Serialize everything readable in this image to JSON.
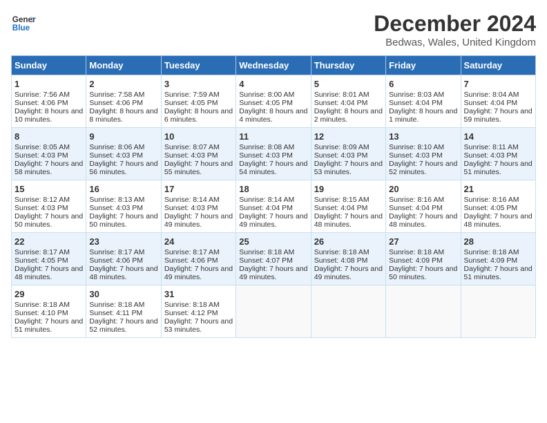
{
  "header": {
    "logo_line1": "General",
    "logo_line2": "Blue",
    "month": "December 2024",
    "location": "Bedwas, Wales, United Kingdom"
  },
  "days_of_week": [
    "Sunday",
    "Monday",
    "Tuesday",
    "Wednesday",
    "Thursday",
    "Friday",
    "Saturday"
  ],
  "weeks": [
    [
      {
        "day": "1",
        "sunrise": "Sunrise: 7:56 AM",
        "sunset": "Sunset: 4:06 PM",
        "daylight": "Daylight: 8 hours and 10 minutes."
      },
      {
        "day": "2",
        "sunrise": "Sunrise: 7:58 AM",
        "sunset": "Sunset: 4:06 PM",
        "daylight": "Daylight: 8 hours and 8 minutes."
      },
      {
        "day": "3",
        "sunrise": "Sunrise: 7:59 AM",
        "sunset": "Sunset: 4:05 PM",
        "daylight": "Daylight: 8 hours and 6 minutes."
      },
      {
        "day": "4",
        "sunrise": "Sunrise: 8:00 AM",
        "sunset": "Sunset: 4:05 PM",
        "daylight": "Daylight: 8 hours and 4 minutes."
      },
      {
        "day": "5",
        "sunrise": "Sunrise: 8:01 AM",
        "sunset": "Sunset: 4:04 PM",
        "daylight": "Daylight: 8 hours and 2 minutes."
      },
      {
        "day": "6",
        "sunrise": "Sunrise: 8:03 AM",
        "sunset": "Sunset: 4:04 PM",
        "daylight": "Daylight: 8 hours and 1 minute."
      },
      {
        "day": "7",
        "sunrise": "Sunrise: 8:04 AM",
        "sunset": "Sunset: 4:04 PM",
        "daylight": "Daylight: 7 hours and 59 minutes."
      }
    ],
    [
      {
        "day": "8",
        "sunrise": "Sunrise: 8:05 AM",
        "sunset": "Sunset: 4:03 PM",
        "daylight": "Daylight: 7 hours and 58 minutes."
      },
      {
        "day": "9",
        "sunrise": "Sunrise: 8:06 AM",
        "sunset": "Sunset: 4:03 PM",
        "daylight": "Daylight: 7 hours and 56 minutes."
      },
      {
        "day": "10",
        "sunrise": "Sunrise: 8:07 AM",
        "sunset": "Sunset: 4:03 PM",
        "daylight": "Daylight: 7 hours and 55 minutes."
      },
      {
        "day": "11",
        "sunrise": "Sunrise: 8:08 AM",
        "sunset": "Sunset: 4:03 PM",
        "daylight": "Daylight: 7 hours and 54 minutes."
      },
      {
        "day": "12",
        "sunrise": "Sunrise: 8:09 AM",
        "sunset": "Sunset: 4:03 PM",
        "daylight": "Daylight: 7 hours and 53 minutes."
      },
      {
        "day": "13",
        "sunrise": "Sunrise: 8:10 AM",
        "sunset": "Sunset: 4:03 PM",
        "daylight": "Daylight: 7 hours and 52 minutes."
      },
      {
        "day": "14",
        "sunrise": "Sunrise: 8:11 AM",
        "sunset": "Sunset: 4:03 PM",
        "daylight": "Daylight: 7 hours and 51 minutes."
      }
    ],
    [
      {
        "day": "15",
        "sunrise": "Sunrise: 8:12 AM",
        "sunset": "Sunset: 4:03 PM",
        "daylight": "Daylight: 7 hours and 50 minutes."
      },
      {
        "day": "16",
        "sunrise": "Sunrise: 8:13 AM",
        "sunset": "Sunset: 4:03 PM",
        "daylight": "Daylight: 7 hours and 50 minutes."
      },
      {
        "day": "17",
        "sunrise": "Sunrise: 8:14 AM",
        "sunset": "Sunset: 4:03 PM",
        "daylight": "Daylight: 7 hours and 49 minutes."
      },
      {
        "day": "18",
        "sunrise": "Sunrise: 8:14 AM",
        "sunset": "Sunset: 4:04 PM",
        "daylight": "Daylight: 7 hours and 49 minutes."
      },
      {
        "day": "19",
        "sunrise": "Sunrise: 8:15 AM",
        "sunset": "Sunset: 4:04 PM",
        "daylight": "Daylight: 7 hours and 48 minutes."
      },
      {
        "day": "20",
        "sunrise": "Sunrise: 8:16 AM",
        "sunset": "Sunset: 4:04 PM",
        "daylight": "Daylight: 7 hours and 48 minutes."
      },
      {
        "day": "21",
        "sunrise": "Sunrise: 8:16 AM",
        "sunset": "Sunset: 4:05 PM",
        "daylight": "Daylight: 7 hours and 48 minutes."
      }
    ],
    [
      {
        "day": "22",
        "sunrise": "Sunrise: 8:17 AM",
        "sunset": "Sunset: 4:05 PM",
        "daylight": "Daylight: 7 hours and 48 minutes."
      },
      {
        "day": "23",
        "sunrise": "Sunrise: 8:17 AM",
        "sunset": "Sunset: 4:06 PM",
        "daylight": "Daylight: 7 hours and 48 minutes."
      },
      {
        "day": "24",
        "sunrise": "Sunrise: 8:17 AM",
        "sunset": "Sunset: 4:06 PM",
        "daylight": "Daylight: 7 hours and 49 minutes."
      },
      {
        "day": "25",
        "sunrise": "Sunrise: 8:18 AM",
        "sunset": "Sunset: 4:07 PM",
        "daylight": "Daylight: 7 hours and 49 minutes."
      },
      {
        "day": "26",
        "sunrise": "Sunrise: 8:18 AM",
        "sunset": "Sunset: 4:08 PM",
        "daylight": "Daylight: 7 hours and 49 minutes."
      },
      {
        "day": "27",
        "sunrise": "Sunrise: 8:18 AM",
        "sunset": "Sunset: 4:09 PM",
        "daylight": "Daylight: 7 hours and 50 minutes."
      },
      {
        "day": "28",
        "sunrise": "Sunrise: 8:18 AM",
        "sunset": "Sunset: 4:09 PM",
        "daylight": "Daylight: 7 hours and 51 minutes."
      }
    ],
    [
      {
        "day": "29",
        "sunrise": "Sunrise: 8:18 AM",
        "sunset": "Sunset: 4:10 PM",
        "daylight": "Daylight: 7 hours and 51 minutes."
      },
      {
        "day": "30",
        "sunrise": "Sunrise: 8:18 AM",
        "sunset": "Sunset: 4:11 PM",
        "daylight": "Daylight: 7 hours and 52 minutes."
      },
      {
        "day": "31",
        "sunrise": "Sunrise: 8:18 AM",
        "sunset": "Sunset: 4:12 PM",
        "daylight": "Daylight: 7 hours and 53 minutes."
      },
      {
        "day": "",
        "sunrise": "",
        "sunset": "",
        "daylight": ""
      },
      {
        "day": "",
        "sunrise": "",
        "sunset": "",
        "daylight": ""
      },
      {
        "day": "",
        "sunrise": "",
        "sunset": "",
        "daylight": ""
      },
      {
        "day": "",
        "sunrise": "",
        "sunset": "",
        "daylight": ""
      }
    ]
  ]
}
